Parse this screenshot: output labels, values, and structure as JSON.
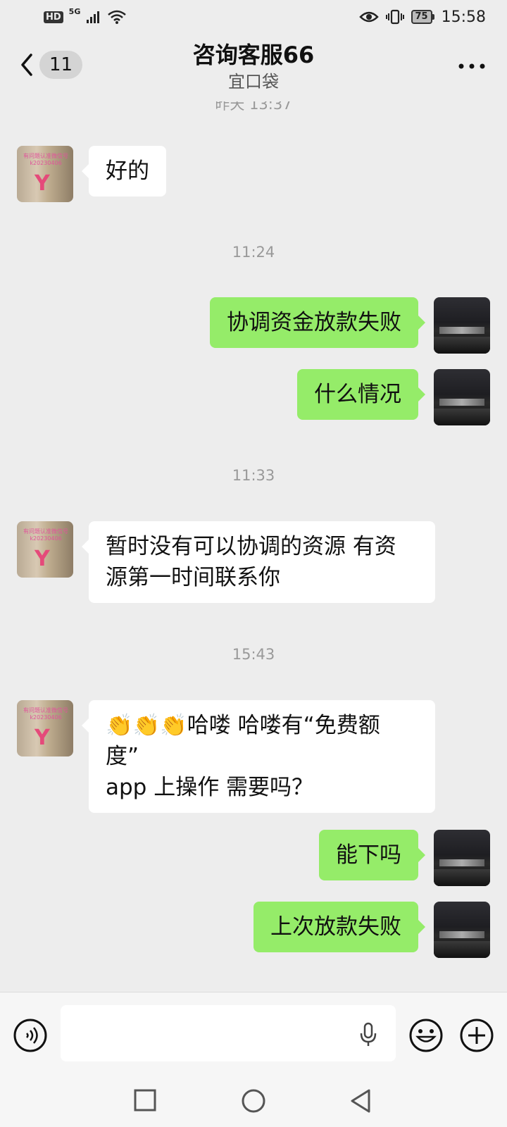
{
  "status_bar": {
    "hd": "HD",
    "network": "5G",
    "battery": "75",
    "time": "15:58"
  },
  "header": {
    "unread_count": "11",
    "title": "咨询客服66",
    "subtitle": "宜口袋"
  },
  "messages": {
    "partial_time": "昨天 13:37",
    "m1": {
      "text": "好的"
    },
    "time1": "11:24",
    "m2": {
      "text": "协调资金放款失败"
    },
    "m3": {
      "text": "什么情况"
    },
    "time2": "11:33",
    "m4": {
      "line1": "暂时没有可以协调的资源 有资",
      "line2": "源第一时间联系你"
    },
    "time3": "15:43",
    "m5": {
      "emoji": "👏👏👏",
      "line1": "哈喽  哈喽有“免费额",
      "line2": "度”",
      "line3": "app 上操作   需要吗？"
    },
    "m6": {
      "text": "能下吗"
    },
    "m7": {
      "text": "上次放款失败"
    }
  },
  "avatar_left": {
    "caption": "有问题认准微信号 k20230406",
    "initial": "Y"
  },
  "input": {
    "value": ""
  },
  "colors": {
    "sent_bubble": "#95ec69",
    "received_bubble": "#ffffff",
    "background": "#ededed"
  }
}
